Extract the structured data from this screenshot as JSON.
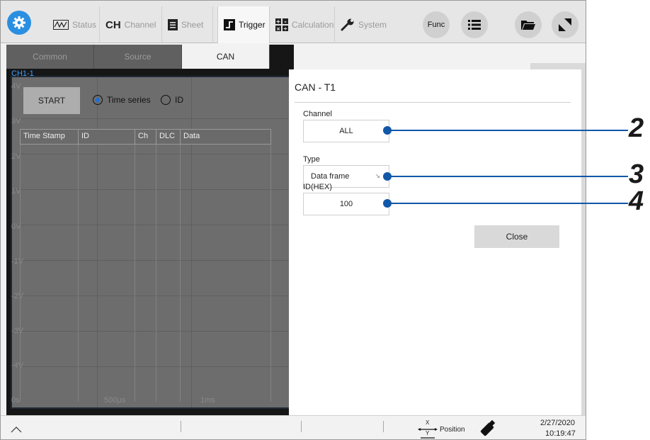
{
  "toolbar": {
    "tabs": [
      {
        "label": "Status",
        "icon": "status-icon",
        "active": false
      },
      {
        "label": "Channel",
        "icon": "CH",
        "active": false
      },
      {
        "label": "Sheet",
        "icon": "sheet-icon",
        "active": false
      },
      {
        "label": "Trigger",
        "icon": "trigger-icon",
        "active": true
      },
      {
        "label": "Calculation",
        "icon": "calculation-icon",
        "active": false
      },
      {
        "label": "System",
        "icon": "wrench-icon",
        "active": false
      }
    ],
    "func_label": "Func"
  },
  "subtabs": [
    {
      "label": "Common",
      "active": false
    },
    {
      "label": "Source",
      "active": false
    },
    {
      "label": "CAN",
      "active": true
    }
  ],
  "screen": {
    "channel_label": "CH1-1",
    "y_ticks": [
      "4V",
      "3V",
      "2V",
      "1V",
      "0V",
      "-1V",
      "-2V",
      "-3V",
      "-4V"
    ],
    "x_ticks": [
      "0s",
      "500μs",
      "1ms"
    ],
    "start_label": "START",
    "radio_time_series": "Time series",
    "radio_id": "ID",
    "selected_radio": "Time series",
    "table_headers": [
      "Time Stamp",
      "ID",
      "Ch",
      "DLC",
      "Data"
    ]
  },
  "dialog": {
    "title": "CAN - T1",
    "channel_label": "Channel",
    "channel_value": "ALL",
    "type_label": "Type",
    "type_value": "Data frame",
    "id_label": "ID(HEX)",
    "id_value": "100",
    "close_label": "Close"
  },
  "statusbar": {
    "position_label": "Position",
    "position_x": "X",
    "position_y": "Y",
    "date": "2/27/2020",
    "time": "10:19:47"
  },
  "callouts": [
    "2",
    "3",
    "4"
  ],
  "colors": {
    "accent": "#2a8fe0",
    "callout_line": "#1057a8",
    "plot_bg": "#6d6d6d",
    "screen_bg": "#161616"
  }
}
